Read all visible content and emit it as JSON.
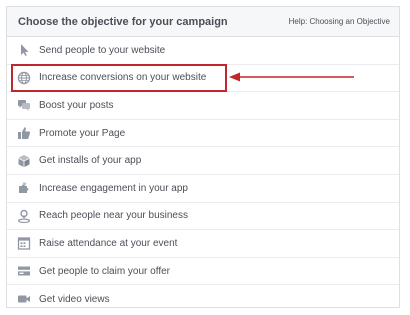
{
  "header": {
    "title": "Choose the objective for your campaign",
    "help_link": "Help: Choosing an Objective"
  },
  "objectives": [
    {
      "label": "Send people to your website",
      "icon": "cursor-icon"
    },
    {
      "label": "Increase conversions on your website",
      "icon": "globe-icon"
    },
    {
      "label": "Boost your posts",
      "icon": "chat-bubbles-icon"
    },
    {
      "label": "Promote your Page",
      "icon": "thumbs-up-icon"
    },
    {
      "label": "Get installs of your app",
      "icon": "box-icon"
    },
    {
      "label": "Increase engagement in your app",
      "icon": "puzzle-icon"
    },
    {
      "label": "Reach people near your business",
      "icon": "location-person-icon"
    },
    {
      "label": "Raise attendance at your event",
      "icon": "calendar-icon"
    },
    {
      "label": "Get people to claim your offer",
      "icon": "offer-icon"
    },
    {
      "label": "Get video views",
      "icon": "video-camera-icon"
    }
  ],
  "annotation": {
    "highlighted_item": "Increase conversions on your website",
    "color": "#c0272d"
  },
  "colors": {
    "icon": "#9197a3",
    "text": "#4b4f56",
    "header_bg": "#f6f7f9",
    "border": "#dddfe2"
  }
}
